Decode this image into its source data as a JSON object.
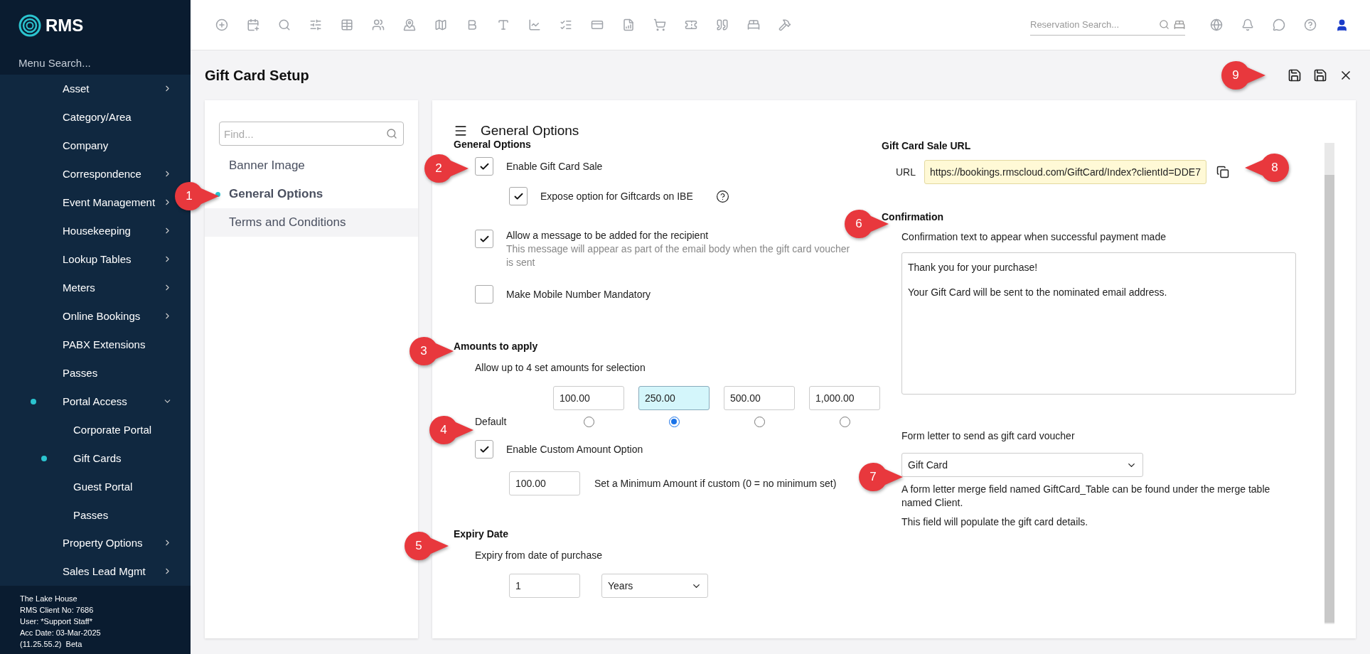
{
  "sidebar": {
    "logo": "RMS",
    "search_placeholder": "Menu Search...",
    "items": [
      {
        "label": "Asset",
        "expanded": false,
        "active": false
      },
      {
        "label": "Category/Area",
        "active": false
      },
      {
        "label": "Company",
        "active": false
      },
      {
        "label": "Correspondence",
        "expanded": false,
        "active": false
      },
      {
        "label": "Event Management",
        "expanded": false,
        "active": false
      },
      {
        "label": "Housekeeping",
        "expanded": false,
        "active": false
      },
      {
        "label": "Lookup Tables",
        "expanded": false,
        "active": false
      },
      {
        "label": "Meters",
        "expanded": false,
        "active": false
      },
      {
        "label": "Online Bookings",
        "expanded": false,
        "active": false
      },
      {
        "label": "PABX Extensions",
        "active": false
      },
      {
        "label": "Passes",
        "active": false
      },
      {
        "label": "Portal Access",
        "expanded": true,
        "active": true,
        "children": [
          {
            "label": "Corporate Portal",
            "active": false
          },
          {
            "label": "Gift Cards",
            "active": true
          },
          {
            "label": "Guest Portal",
            "active": false
          },
          {
            "label": "Passes",
            "active": false
          }
        ]
      },
      {
        "label": "Property Options",
        "expanded": false,
        "active": false
      },
      {
        "label": "Sales Lead Mgmt",
        "expanded": false,
        "active": false
      }
    ],
    "footer": [
      "The Lake House",
      "RMS Client No: 7686",
      "User: *Support Staff*",
      "Acc Date: 03-Mar-2025",
      "(11.25.55.2)  Beta"
    ]
  },
  "toolbar": {
    "search_placeholder": "Reservation Search..."
  },
  "page_title": "Gift Card Setup",
  "nav": {
    "find_placeholder": "Find...",
    "items": [
      {
        "label": "Banner Image",
        "selected": false
      },
      {
        "label": "General Options",
        "selected": true
      },
      {
        "label": "Terms and Conditions",
        "selected": false
      }
    ]
  },
  "panel": {
    "title": "General Options",
    "section_title": "General Options",
    "options": [
      {
        "label": "Enable Gift Card Sale",
        "checked": true,
        "children": [
          {
            "label": "Expose option for Giftcards on IBE",
            "checked": true,
            "help": true
          }
        ]
      },
      {
        "label": "Allow a message to be added for the recipient",
        "checked": true,
        "note": "This message will appear as part of the email body when the gift card voucher is sent"
      },
      {
        "label": "Make Mobile Number Mandatory",
        "checked": false
      }
    ],
    "amounts": {
      "title": "Amounts to apply",
      "hint": "Allow up to 4 set amounts for selection",
      "default_label": "Default",
      "items": [
        {
          "value": "100.00",
          "selected": false
        },
        {
          "value": "250.00",
          "selected": true
        },
        {
          "value": "500.00",
          "selected": false
        },
        {
          "value": "1,000.00",
          "selected": false
        }
      ]
    },
    "custom": {
      "label": "Enable Custom Amount Option",
      "checked": true,
      "minimum": "100.00",
      "minimum_label": "Set a Minimum Amount if custom (0 = no minimum set)"
    },
    "expiry": {
      "title": "Expiry Date",
      "hint": "Expiry from date of purchase",
      "value": "1",
      "unit": "Years"
    },
    "url": {
      "title": "Gift Card Sale URL",
      "label": "URL",
      "value": "https://bookings.rmscloud.com/GiftCard/Index?clientId=DDE7"
    },
    "confirmation": {
      "title": "Confirmation",
      "hint": "Confirmation text to appear when successful payment made",
      "paragraphs": [
        "Thank you for your purchase!",
        "Your Gift Card will be sent to the nominated email address."
      ]
    },
    "form_letter": {
      "label": "Form letter to send as gift card voucher",
      "value": "Gift Card",
      "notes": [
        "A form letter merge field named GiftCard_Table can be found under the merge table named Client.",
        "This field will populate the gift card details."
      ]
    }
  },
  "callouts": [
    "1",
    "2",
    "3",
    "4",
    "5",
    "6",
    "7",
    "8",
    "9"
  ]
}
